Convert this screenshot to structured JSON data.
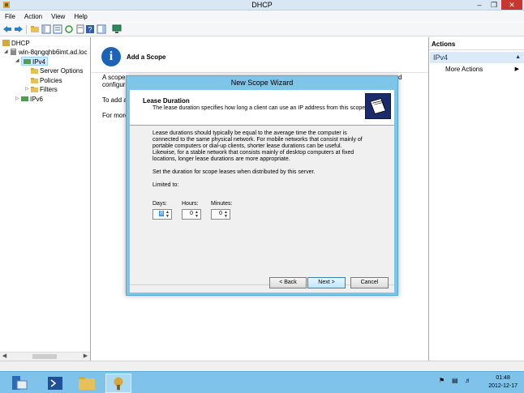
{
  "window": {
    "title": "DHCP"
  },
  "menu": [
    "File",
    "Action",
    "View",
    "Help"
  ],
  "tree": {
    "root": "DHCP",
    "server": "win-8qngqhb6imt.ad.loc",
    "ipv4": "IPv4",
    "server_options": "Server Options",
    "policies": "Policies",
    "filters": "Filters",
    "ipv6": "IPv6"
  },
  "main": {
    "heading": "Add a Scope",
    "line1_start": "A scope",
    "line1_end": "d",
    "line2_start": "configur",
    "line3_start": "To add a",
    "line4_start": "For more"
  },
  "actions": {
    "header": "Actions",
    "section": "IPv4",
    "more_actions": "More Actions"
  },
  "dialog": {
    "title": "New Scope Wizard",
    "page_title": "Lease Duration",
    "page_subtitle": "The lease duration specifies how long a client can use an IP address from this scope.",
    "body_lines": [
      "Lease durations should typically be equal to the average time the computer is",
      "connected to the same physical network. For mobile networks that consist mainly of",
      "portable computers or dial-up clients, shorter lease durations can be useful.",
      "Likewise, for a stable network that consists mainly of desktop computers at fixed",
      "locations, longer lease durations are more appropriate."
    ],
    "set_duration": "Set the duration for scope leases when distributed by this server.",
    "limited_to": "Limited to:",
    "days_label": "Days:",
    "hours_label": "Hours:",
    "minutes_label": "Minutes:",
    "days_value": "8",
    "hours_value": "0",
    "minutes_value": "0",
    "back_button": "< Back",
    "next_button": "Next >",
    "cancel_button": "Cancel"
  },
  "taskbar": {
    "time": "01:48",
    "date": "2012-12-17"
  },
  "colors": {
    "dialog_frame": "#7ec5ea",
    "taskbar": "#7fc3eb",
    "close_button": "#c7372f",
    "selection": "#cde8ff"
  }
}
